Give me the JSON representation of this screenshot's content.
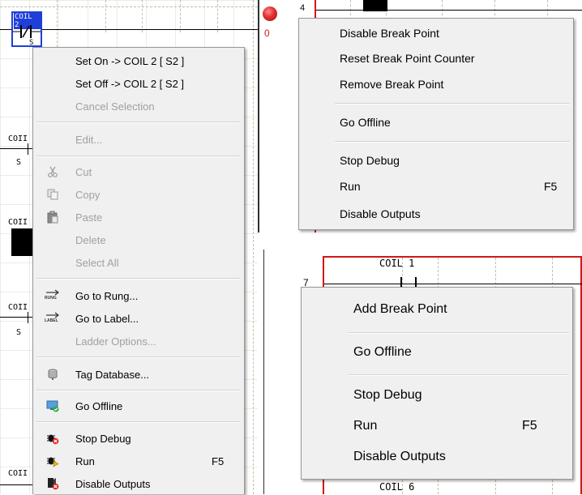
{
  "ladder": {
    "left_panel": {
      "coil_labels": [
        "COIL 2",
        "COII",
        "COII",
        "COII",
        "COII"
      ],
      "contact_marks": [
        "S",
        "S",
        "S"
      ]
    },
    "top_right_panel": {
      "rung_number": "4",
      "breakpoint_counter": "0"
    },
    "bottom_right_panel": {
      "rung_number": "7",
      "coil_top": "COIL 1",
      "coil_bottom": "COIL 6"
    }
  },
  "menus": {
    "left": {
      "items": [
        {
          "label": "Set On -> COIL 2 [ S2 ]",
          "icon": "",
          "shortcut": "",
          "enabled": true
        },
        {
          "label": "Set Off -> COIL 2 [ S2 ]",
          "icon": "",
          "shortcut": "",
          "enabled": true
        },
        {
          "label": "Cancel Selection",
          "icon": "",
          "shortcut": "",
          "enabled": false
        },
        {
          "label": "Edit...",
          "icon": "",
          "shortcut": "",
          "enabled": false
        },
        {
          "label": "Cut",
          "icon": "scissors-icon",
          "shortcut": "",
          "enabled": false
        },
        {
          "label": "Copy",
          "icon": "copy-icon",
          "shortcut": "",
          "enabled": false
        },
        {
          "label": "Paste",
          "icon": "paste-icon",
          "shortcut": "",
          "enabled": false
        },
        {
          "label": "Delete",
          "icon": "",
          "shortcut": "",
          "enabled": false
        },
        {
          "label": "Select All",
          "icon": "",
          "shortcut": "",
          "enabled": false
        },
        {
          "label": "Go to Rung...",
          "icon": "goto-rung-icon",
          "icon_text": "RUNG",
          "shortcut": "",
          "enabled": true
        },
        {
          "label": "Go to Label...",
          "icon": "goto-label-icon",
          "icon_text": "LABEL",
          "shortcut": "",
          "enabled": true
        },
        {
          "label": "Ladder Options...",
          "icon": "",
          "shortcut": "",
          "enabled": false
        },
        {
          "label": "Tag Database...",
          "icon": "database-icon",
          "shortcut": "",
          "enabled": true
        },
        {
          "label": "Go Offline",
          "icon": "go-offline-icon",
          "shortcut": "",
          "enabled": true
        },
        {
          "label": "Stop Debug",
          "icon": "stop-debug-icon",
          "shortcut": "",
          "enabled": true
        },
        {
          "label": "Run",
          "icon": "run-icon",
          "shortcut": "F5",
          "enabled": true
        },
        {
          "label": "Disable Outputs",
          "icon": "disable-outputs-icon",
          "shortcut": "",
          "enabled": true
        }
      ]
    },
    "top_right": {
      "items": [
        {
          "label": "Disable Break Point",
          "shortcut": ""
        },
        {
          "label": "Reset Break Point Counter",
          "shortcut": ""
        },
        {
          "label": "Remove Break Point",
          "shortcut": ""
        },
        {
          "label": "Go Offline",
          "shortcut": ""
        },
        {
          "label": "Stop Debug",
          "shortcut": ""
        },
        {
          "label": "Run",
          "shortcut": "F5"
        },
        {
          "label": "Disable Outputs",
          "shortcut": ""
        }
      ]
    },
    "bottom_right": {
      "items": [
        {
          "label": "Add Break Point",
          "shortcut": ""
        },
        {
          "label": "Go Offline",
          "shortcut": ""
        },
        {
          "label": "Stop Debug",
          "shortcut": ""
        },
        {
          "label": "Run",
          "shortcut": "F5"
        },
        {
          "label": "Disable Outputs",
          "shortcut": ""
        }
      ]
    }
  },
  "colors": {
    "breakpoint_dot": "#e03030",
    "rail_red": "#d01818",
    "selection_blue": "#1f3fd8",
    "disabled_text": "#a0a0a0"
  }
}
